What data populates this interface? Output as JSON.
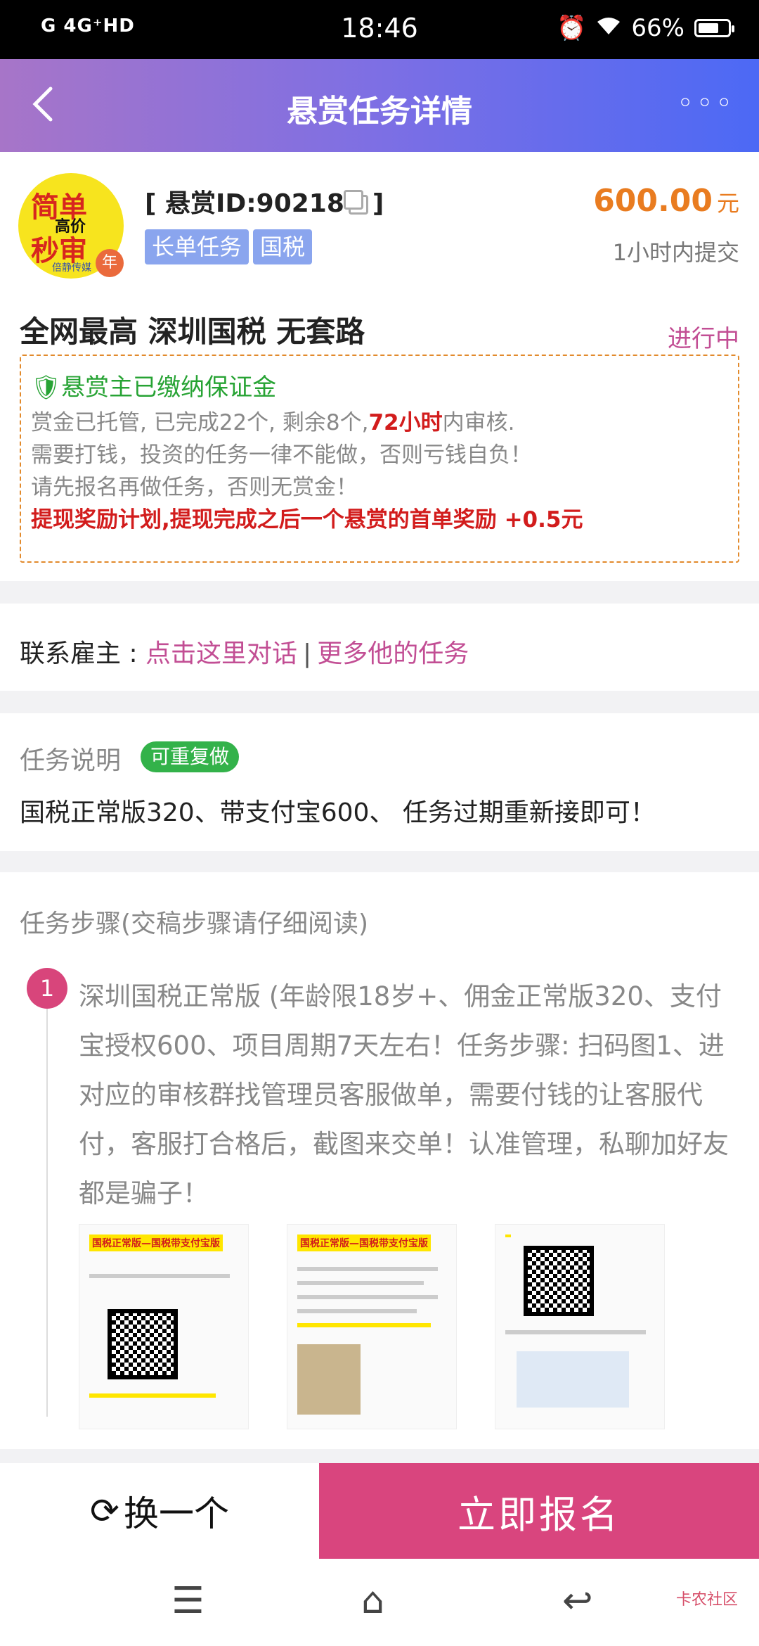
{
  "status_bar": {
    "signal": "G 4G⁺HD",
    "time": "18:46",
    "battery": "66%"
  },
  "app_bar": {
    "title": "悬赏任务详情",
    "more": "◦◦◦"
  },
  "task": {
    "avatar": {
      "line1": "简单",
      "line2": "高价",
      "line3": "秒审",
      "brand": "倍静传媒",
      "badge": "年"
    },
    "id_prefix": "[ 悬赏ID:90218",
    "id_suffix": "]",
    "tags": [
      "长单任务",
      "国税"
    ],
    "price": "600.00",
    "price_unit": "元",
    "submit_time": "1小时内提交",
    "title": "全网最高 深圳国税 无套路",
    "status": "进行中"
  },
  "notice": {
    "deposit": "悬赏主已缴纳保证金",
    "line1_a": "赏金已托管, 已完成22个, 剩余8个,",
    "line1_hl": "72小时",
    "line1_b": "内审核.",
    "line2": "需要打钱，投资的任务一律不能做，否则亏钱自负！",
    "line3": "请先报名再做任务，否则无赏金！",
    "line4": "提现奖励计划,提现完成之后一个悬赏的首单奖励 +0.5元"
  },
  "contact": {
    "label": "联系雇主 : ",
    "chat": "点击这里对话",
    "sep": "|",
    "more": "更多他的任务"
  },
  "description": {
    "heading": "任务说明",
    "badge": "可重复做",
    "body": "国税正常版320、带支付宝600、 任务过期重新接即可！"
  },
  "steps": {
    "heading": "任务步骤(交稿步骤请仔细阅读)",
    "items": [
      {
        "num": "1",
        "text": "深圳国税正常版 (年龄限18岁+、佣金正常版320、支付宝授权600、项目周期7天左右！任务步骤: 扫码图1、进对应的审核群找管理员客服做单，需要付钱的让客服代付，客服打合格后，截图来交单！认准管理，私聊加好友都是骗子！",
        "images": [
          "国税正常版—国税带支付宝版",
          "国税正常版—国税带支付宝版",
          ""
        ]
      }
    ]
  },
  "bottom": {
    "swap": "换一个",
    "apply": "立即报名"
  },
  "navbar": {
    "menu": "☰",
    "home": "⌂",
    "back": "↩",
    "watermark": "卡农社区"
  },
  "colors": {
    "accent": "#d9457e",
    "price": "#e97c20",
    "link": "#c24e94",
    "green": "#27a334",
    "red": "#d21c1c"
  }
}
